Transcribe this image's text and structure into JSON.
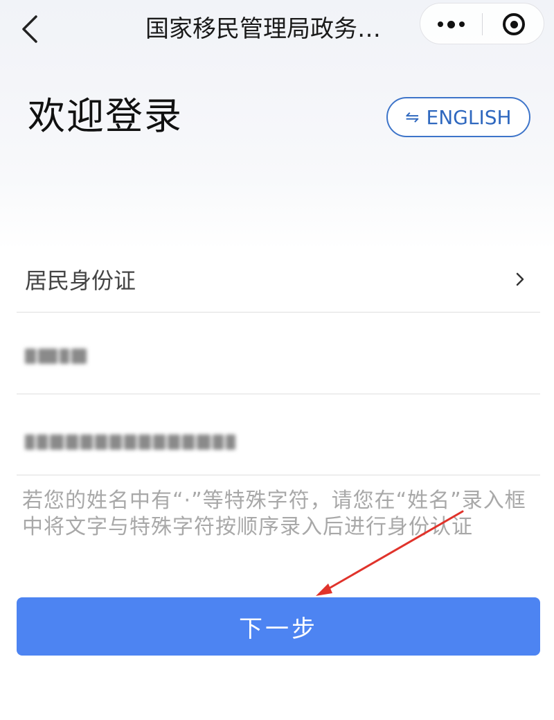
{
  "nav": {
    "title": "国家移民管理局政务…",
    "back_icon": "chevron-left-icon",
    "more_icon": "more-dots-icon",
    "close_icon": "target-circle-icon"
  },
  "header": {
    "title": "欢迎登录",
    "language_button": {
      "icon": "swap-arrows-icon",
      "icon_glyph": "⇋",
      "label": "ENGLISH"
    }
  },
  "form": {
    "id_type": {
      "value": "居民身份证",
      "chevron_icon": "chevron-right-icon"
    },
    "name_field": {
      "blurred": true
    },
    "id_number_field": {
      "blurred": true
    }
  },
  "hint_text": "若您的姓名中有“·”等特殊字符，请您在“姓名”录入框中将文字与特殊字符按顺序录入后进行身份认证",
  "next_button": {
    "label": "下一步"
  },
  "colors": {
    "accent": "#4d84f2",
    "language_border": "#3d74c9",
    "annotation_arrow": "#e0332b"
  }
}
